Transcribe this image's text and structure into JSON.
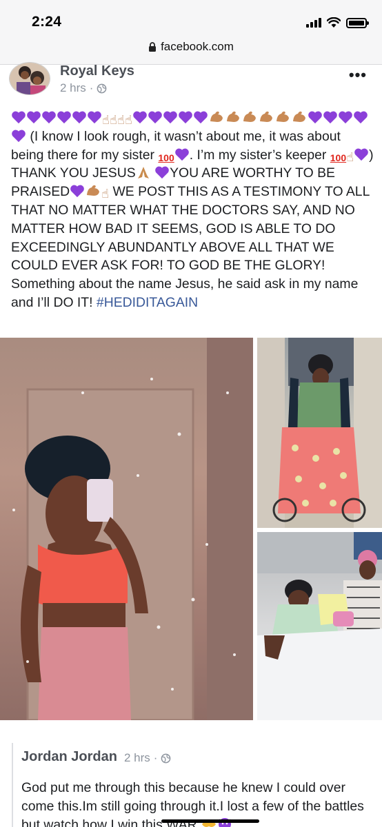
{
  "status_bar": {
    "time": "2:24"
  },
  "browser": {
    "url": "facebook.com"
  },
  "post": {
    "author": "Royal Keys",
    "timestamp": "2 hrs",
    "separator": "·",
    "more_label": "•••",
    "text_segments": {
      "s1": "(I know I look rough, it wasn’t about me, it was about being there for my sister ",
      "s2": ". I’m my sister’s keeper ",
      "s3": ") THANK YOU JESUS",
      "s4": "YOU ARE WORTHY TO BE PRAISED",
      "s5": "WE POST THIS AS A TESTIMONY TO ALL THAT NO MATTER WHAT THE DOCTORS SAY, AND NO MATTER HOW BAD IT SEEMS, GOD IS ABLE TO DO EXCEEDINGLY ABUNDANTLY ABOVE ALL THAT WE COULD EVER ASK FOR! TO GOD BE THE GLORY! Something about the name Jesus, he said ask in my name and I’ll DO IT! ",
      "hashtag": "#HEDIDITAGAIN"
    },
    "emoji": {
      "hundred": "100",
      "finger": "☝",
      "muscle": "ප",
      "praying": "✶"
    },
    "photos": [
      {
        "icon": "selfie-photo"
      },
      {
        "icon": "wheelchair-photo"
      },
      {
        "icon": "hospital-bed-photo"
      }
    ]
  },
  "comment": {
    "author": "Jordan Jordan",
    "timestamp": "2 hrs",
    "separator": "·",
    "text": "God put me through this because he knew I could over come this.Im still going through it.I lost a few of the battles but watch how I win this WAR "
  },
  "colors": {
    "heart": "#8b3fd9",
    "link": "#385898",
    "meta": "#8d949e"
  }
}
